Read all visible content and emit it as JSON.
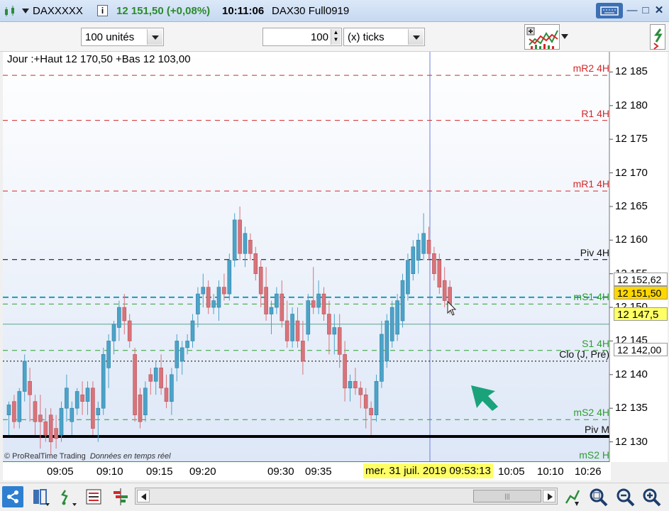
{
  "titlebar": {
    "instrument": "DAXXXXX",
    "last_price": "12 151,50 (+0,08%)",
    "time": "10:11:06",
    "contract": "DAX30 Full0919"
  },
  "toolbar": {
    "units_select": "100 unités",
    "ticks_value": "100",
    "ticks_select": "(x) ticks"
  },
  "chart_header": "Jour :+Haut 12 170,50 +Bas 12 103,00",
  "watermark": {
    "brand": "© ProRealTime Trading",
    "note": "Données en temps réel"
  },
  "levels": [
    {
      "name": "mR2 4H",
      "price": 12184.5,
      "color": "#d62728",
      "style": "dash"
    },
    {
      "name": "R1 4H",
      "price": 12177.8,
      "color": "#d62728",
      "style": "dash"
    },
    {
      "name": "mR1 4H",
      "price": 12167.3,
      "color": "#d62728",
      "style": "dash"
    },
    {
      "name": "Piv 4H",
      "price": 12157.1,
      "color": "#000000",
      "style": "dash"
    },
    {
      "name": "mS1 4H",
      "price": 12150.5,
      "color": "#2e9d2e",
      "style": "dash"
    },
    {
      "name": "S1 4H",
      "price": 12143.6,
      "color": "#2e9d2e",
      "style": "dash"
    },
    {
      "name": "Clo (J, Pré)",
      "price": 12142.0,
      "color": "#000000",
      "style": "dot"
    },
    {
      "name": "mS2 4H",
      "price": 12133.3,
      "color": "#2e9d2e",
      "style": "dash"
    },
    {
      "name": "Piv M",
      "price": 12130.8,
      "color": "#000000",
      "style": "thick"
    },
    {
      "name": "mS2 H",
      "price": 12127.0,
      "color": "#2e9d2e",
      "style": "solid"
    }
  ],
  "price_axis": {
    "ticks": [
      "12 185",
      "12 180",
      "12 175",
      "12 170",
      "12 165",
      "12 160",
      "12 155",
      "12 150",
      "12 145",
      "12 140",
      "12 135",
      "12 130"
    ],
    "current_box": "12 151,50",
    "cursor_box": "12 152,62",
    "line_box": "12 147,5",
    "close_box": "12 142,00"
  },
  "time_axis": {
    "ticks": [
      "09:05",
      "09:10",
      "09:15",
      "09:20",
      "09:30",
      "09:35",
      "10:05",
      "10:10",
      "10:26"
    ],
    "cursor_label": "mer. 31 juil. 2019 09:53:13"
  },
  "colors": {
    "up": "#4ca3c8",
    "down": "#d9737a",
    "accent": "#1aa37a",
    "price_highlight": "#ffd700"
  },
  "chart_data": {
    "type": "candlestick",
    "ylim": [
      12127,
      12188
    ],
    "candles": [
      {
        "o": 12134,
        "h": 12136,
        "l": 12131,
        "c": 12135.5
      },
      {
        "o": 12136,
        "h": 12137,
        "l": 12132,
        "c": 12133
      },
      {
        "o": 12133,
        "h": 12138,
        "l": 12132,
        "c": 12137.5
      },
      {
        "o": 12137.5,
        "h": 12143,
        "l": 12136,
        "c": 12142
      },
      {
        "o": 12139,
        "h": 12141,
        "l": 12133,
        "c": 12137
      },
      {
        "o": 12136,
        "h": 12137,
        "l": 12131,
        "c": 12133
      },
      {
        "o": 12134,
        "h": 12137,
        "l": 12129,
        "c": 12133
      },
      {
        "o": 12133,
        "h": 12135,
        "l": 12130,
        "c": 12131
      },
      {
        "o": 12134,
        "h": 12135,
        "l": 12128,
        "c": 12130
      },
      {
        "o": 12132,
        "h": 12134,
        "l": 12129,
        "c": 12130.5
      },
      {
        "o": 12131,
        "h": 12136,
        "l": 12130,
        "c": 12135
      },
      {
        "o": 12135,
        "h": 12140,
        "l": 12133,
        "c": 12138
      },
      {
        "o": 12133,
        "h": 12136,
        "l": 12131,
        "c": 12135
      },
      {
        "o": 12135,
        "h": 12138,
        "l": 12134,
        "c": 12137.5
      },
      {
        "o": 12137,
        "h": 12139,
        "l": 12134,
        "c": 12136
      },
      {
        "o": 12136,
        "h": 12139,
        "l": 12134,
        "c": 12138
      },
      {
        "o": 12138,
        "h": 12139,
        "l": 12131,
        "c": 12132
      },
      {
        "o": 12134,
        "h": 12136,
        "l": 12130,
        "c": 12135
      },
      {
        "o": 12135,
        "h": 12144,
        "l": 12134,
        "c": 12143
      },
      {
        "o": 12141,
        "h": 12146,
        "l": 12138,
        "c": 12145
      },
      {
        "o": 12145,
        "h": 12148,
        "l": 12143,
        "c": 12147.5
      },
      {
        "o": 12147,
        "h": 12151,
        "l": 12145,
        "c": 12150
      },
      {
        "o": 12150,
        "h": 12152,
        "l": 12146,
        "c": 12148
      },
      {
        "o": 12148,
        "h": 12149,
        "l": 12144,
        "c": 12145
      },
      {
        "o": 12143,
        "h": 12144,
        "l": 12133,
        "c": 12134
      },
      {
        "o": 12137,
        "h": 12138,
        "l": 12132,
        "c": 12133
      },
      {
        "o": 12134,
        "h": 12139,
        "l": 12133,
        "c": 12138
      },
      {
        "o": 12140,
        "h": 12141,
        "l": 12137,
        "c": 12139
      },
      {
        "o": 12139,
        "h": 12142,
        "l": 12137,
        "c": 12141
      },
      {
        "o": 12141,
        "h": 12143,
        "l": 12137,
        "c": 12138
      },
      {
        "o": 12138,
        "h": 12140,
        "l": 12135,
        "c": 12136
      },
      {
        "o": 12136,
        "h": 12141,
        "l": 12134,
        "c": 12140
      },
      {
        "o": 12141,
        "h": 12146,
        "l": 12139,
        "c": 12145
      },
      {
        "o": 12142,
        "h": 12145,
        "l": 12140,
        "c": 12144
      },
      {
        "o": 12144,
        "h": 12146,
        "l": 12143,
        "c": 12145
      },
      {
        "o": 12145,
        "h": 12149,
        "l": 12144,
        "c": 12148
      },
      {
        "o": 12149,
        "h": 12153,
        "l": 12147,
        "c": 12152
      },
      {
        "o": 12152,
        "h": 12155,
        "l": 12150,
        "c": 12153
      },
      {
        "o": 12153,
        "h": 12154,
        "l": 12149,
        "c": 12150
      },
      {
        "o": 12150,
        "h": 12152,
        "l": 12149,
        "c": 12151
      },
      {
        "o": 12150,
        "h": 12154,
        "l": 12148,
        "c": 12153
      },
      {
        "o": 12153,
        "h": 12155,
        "l": 12151,
        "c": 12152
      },
      {
        "o": 12152,
        "h": 12158,
        "l": 12151,
        "c": 12157
      },
      {
        "o": 12157,
        "h": 12164,
        "l": 12156,
        "c": 12163
      },
      {
        "o": 12163,
        "h": 12165,
        "l": 12157,
        "c": 12158
      },
      {
        "o": 12158,
        "h": 12162,
        "l": 12156,
        "c": 12161
      },
      {
        "o": 12160,
        "h": 12161,
        "l": 12157,
        "c": 12158
      },
      {
        "o": 12158,
        "h": 12159,
        "l": 12154,
        "c": 12155
      },
      {
        "o": 12156,
        "h": 12157,
        "l": 12150,
        "c": 12152
      },
      {
        "o": 12153,
        "h": 12156,
        "l": 12148,
        "c": 12149
      },
      {
        "o": 12149,
        "h": 12151,
        "l": 12146,
        "c": 12150
      },
      {
        "o": 12150,
        "h": 12153,
        "l": 12149,
        "c": 12152
      },
      {
        "o": 12152,
        "h": 12154,
        "l": 12147,
        "c": 12148
      },
      {
        "o": 12148,
        "h": 12151,
        "l": 12144,
        "c": 12145
      },
      {
        "o": 12145,
        "h": 12150,
        "l": 12144,
        "c": 12149
      },
      {
        "o": 12148,
        "h": 12150,
        "l": 12144,
        "c": 12145
      },
      {
        "o": 12145,
        "h": 12148,
        "l": 12140,
        "c": 12142
      },
      {
        "o": 12146,
        "h": 12152,
        "l": 12145,
        "c": 12151
      },
      {
        "o": 12151,
        "h": 12156,
        "l": 12149,
        "c": 12150
      },
      {
        "o": 12150,
        "h": 12154,
        "l": 12149,
        "c": 12152
      },
      {
        "o": 12152,
        "h": 12153,
        "l": 12148,
        "c": 12149
      },
      {
        "o": 12149,
        "h": 12151,
        "l": 12143,
        "c": 12146
      },
      {
        "o": 12146,
        "h": 12149,
        "l": 12143,
        "c": 12147
      },
      {
        "o": 12147,
        "h": 12149,
        "l": 12141,
        "c": 12143
      },
      {
        "o": 12143,
        "h": 12145,
        "l": 12136,
        "c": 12138
      },
      {
        "o": 12138,
        "h": 12140,
        "l": 12136,
        "c": 12139
      },
      {
        "o": 12139,
        "h": 12141,
        "l": 12137,
        "c": 12138
      },
      {
        "o": 12138,
        "h": 12139,
        "l": 12135,
        "c": 12137
      },
      {
        "o": 12137,
        "h": 12138,
        "l": 12132,
        "c": 12135
      },
      {
        "o": 12135,
        "h": 12136,
        "l": 12131,
        "c": 12134
      },
      {
        "o": 12134,
        "h": 12140,
        "l": 12133,
        "c": 12139
      },
      {
        "o": 12139,
        "h": 12148,
        "l": 12138,
        "c": 12146
      },
      {
        "o": 12142,
        "h": 12149,
        "l": 12141,
        "c": 12148
      },
      {
        "o": 12145,
        "h": 12151,
        "l": 12144,
        "c": 12150
      },
      {
        "o": 12146,
        "h": 12152,
        "l": 12145,
        "c": 12151
      },
      {
        "o": 12148,
        "h": 12155,
        "l": 12147,
        "c": 12154
      },
      {
        "o": 12152,
        "h": 12158,
        "l": 12151,
        "c": 12157
      },
      {
        "o": 12155,
        "h": 12160,
        "l": 12154,
        "c": 12159
      },
      {
        "o": 12157,
        "h": 12161,
        "l": 12155,
        "c": 12160
      },
      {
        "o": 12158,
        "h": 12164,
        "l": 12157,
        "c": 12161
      },
      {
        "o": 12160,
        "h": 12162,
        "l": 12157,
        "c": 12158
      },
      {
        "o": 12158,
        "h": 12159,
        "l": 12154,
        "c": 12155
      },
      {
        "o": 12157,
        "h": 12158,
        "l": 12152,
        "c": 12153
      },
      {
        "o": 12154,
        "h": 12156,
        "l": 12150,
        "c": 12151
      },
      {
        "o": 12153,
        "h": 12154,
        "l": 12149,
        "c": 12150
      }
    ]
  }
}
